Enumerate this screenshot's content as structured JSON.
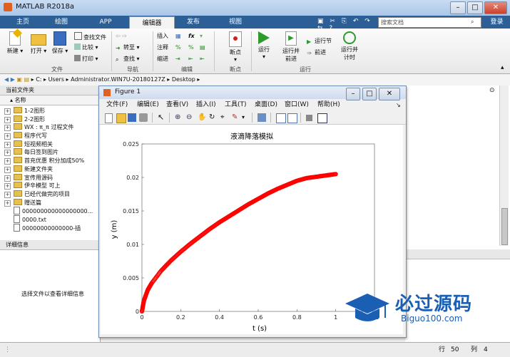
{
  "window": {
    "title": "MATLAB R2018a"
  },
  "tabs": [
    "主页",
    "绘图",
    "APP",
    "编辑器",
    "发布",
    "视图"
  ],
  "active_tab": "编辑器",
  "search": {
    "placeholder": "搜索文档"
  },
  "login_label": "登录",
  "ribbon": {
    "file": {
      "new": "新建",
      "open": "打开",
      "save": "保存",
      "find_files": "查找文件",
      "compare": "比较",
      "print": "打印",
      "label": "文件"
    },
    "navigate": {
      "goto": "转至",
      "find": "查找",
      "label": "导航"
    },
    "edit": {
      "insert": "插入",
      "comment": "注释",
      "indent": "缩进",
      "fx": "fx",
      "label": "编辑"
    },
    "breakpoints": {
      "breakpoint": "断点",
      "label": "断点"
    },
    "run": {
      "run": "运行",
      "run_advance": "运行并\n前进",
      "run_section": "运行节",
      "advance": "前进",
      "run_time": "运行并\n计时",
      "label": "运行"
    }
  },
  "address": {
    "path": [
      "C:",
      "Users",
      "Administrator.WIN7U-20180127Z",
      "Desktop"
    ]
  },
  "current_folder": {
    "title": "当前文件夹",
    "column": "名称",
    "items": [
      {
        "name": "1-2图形",
        "type": "folder"
      },
      {
        "name": "2-2图形",
        "type": "folder"
      },
      {
        "name": "WX : π_π 过程文件",
        "type": "folder"
      },
      {
        "name": "程序代写",
        "type": "folder"
      },
      {
        "name": "短视频相关",
        "type": "folder"
      },
      {
        "name": "每日签到图片",
        "type": "folder"
      },
      {
        "name": "首充优惠 积分加成50%",
        "type": "folder"
      },
      {
        "name": "新建文件夹",
        "type": "folder"
      },
      {
        "name": "宣传用源码",
        "type": "folder"
      },
      {
        "name": "伊辛模型 可上",
        "type": "folder"
      },
      {
        "name": "已经代做完的项目",
        "type": "folder"
      },
      {
        "name": "赠送篇",
        "type": "folder"
      },
      {
        "name": "000000000000000000...",
        "type": "file"
      },
      {
        "name": "0000.txt",
        "type": "file"
      },
      {
        "name": "00000000000000-插",
        "type": "file"
      }
    ]
  },
  "details": {
    "title": "详细信息",
    "message": "选择文件以查看详细信息"
  },
  "figure": {
    "title": "Figure 1",
    "menu": [
      "文件(F)",
      "编辑(E)",
      "查看(V)",
      "插入(I)",
      "工具(T)",
      "桌面(D)",
      "窗口(W)",
      "帮助(H)"
    ]
  },
  "chart_data": {
    "type": "scatter",
    "title": "液滴降落模拟",
    "xlabel": "t (s)",
    "ylabel": "y (m)",
    "xlim": [
      0,
      1.2
    ],
    "ylim": [
      0,
      0.025
    ],
    "xticks": [
      "0",
      "0.2",
      "0.4",
      "0.6",
      "0.8",
      "1",
      "1.2"
    ],
    "yticks": [
      "0",
      "0.005",
      "0.01",
      "0.015",
      "0.02",
      "0.025"
    ],
    "grid": false,
    "marker_color": "#ff0000",
    "x": [
      0,
      0.01,
      0.03,
      0.05,
      0.1,
      0.15,
      0.2,
      0.25,
      0.3,
      0.35,
      0.4,
      0.45,
      0.5,
      0.55,
      0.6,
      0.65,
      0.7,
      0.75,
      0.8,
      0.85,
      0.9,
      0.95,
      1.0
    ],
    "y": [
      0,
      0.0016,
      0.0032,
      0.0042,
      0.0061,
      0.0076,
      0.0089,
      0.0101,
      0.0112,
      0.0123,
      0.0133,
      0.0142,
      0.0151,
      0.016,
      0.0168,
      0.0176,
      0.0183,
      0.0189,
      0.0195,
      0.0199,
      0.0201,
      0.0203,
      0.0205
    ]
  },
  "statusbar": {
    "row_label": "行",
    "row": "50",
    "col_label": "列",
    "col": "4"
  },
  "watermark": {
    "text": "必过源码",
    "url": "Biguo100.com"
  },
  "colors": {
    "accent": "#2b5f95",
    "plot": "#ff0000",
    "watermark": "#1a5fb4"
  }
}
